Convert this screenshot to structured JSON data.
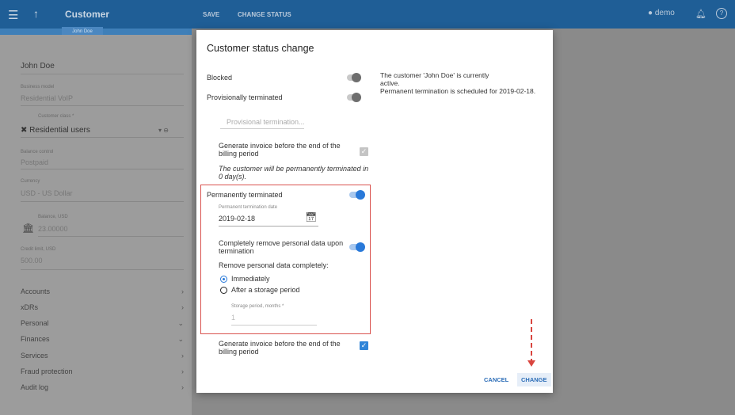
{
  "topbar": {
    "title": "Customer",
    "save_label": "SAVE",
    "change_status_label": "CHANGE STATUS",
    "user": "demo"
  },
  "subbar": {
    "tab_label": "John Doe"
  },
  "sidebar": {
    "name": "John Doe",
    "business_model_label": "Business model",
    "business_model_value": "Residential VoIP",
    "customer_class_label": "Customer class *",
    "customer_class_value": "Residential users",
    "balance_control_label": "Balance control",
    "balance_control_value": "Postpaid",
    "currency_label": "Currency",
    "currency_value": "USD - US Dollar",
    "balance_label": "Balance, USD",
    "balance_value": "23.00000",
    "credit_limit_label": "Credit limit, USD",
    "credit_limit_value": "500.00",
    "nav": [
      {
        "label": "Accounts",
        "chevron": "›"
      },
      {
        "label": "xDRs",
        "chevron": "›"
      },
      {
        "label": "Personal",
        "chevron": "⌄"
      },
      {
        "label": "Finances",
        "chevron": "⌄"
      },
      {
        "label": "Services",
        "chevron": "›"
      },
      {
        "label": "Fraud protection",
        "chevron": "›"
      },
      {
        "label": "Audit log",
        "chevron": "›"
      }
    ]
  },
  "dialog": {
    "title": "Customer status change",
    "blocked_label": "Blocked",
    "provisionally_terminated_label": "Provisionally terminated",
    "status_note": "The customer 'John Doe' is currently active.",
    "termination_note": "Permanent termination is scheduled for 2019-02-18.",
    "provisional_termination_placeholder": "Provisional termination...",
    "generate_invoice_label": "Generate invoice before the end of the billing period",
    "termination_warning": "The customer will be permanently terminated in 0 day(s).",
    "permanently_terminated_label": "Permanently terminated",
    "termination_date_label": "Permanent termination date",
    "termination_date_value": "2019-02-18",
    "remove_data_label": "Completely remove personal data upon termination",
    "remove_data_prompt": "Remove personal data completely:",
    "radio_immediately": "Immediately",
    "radio_after_storage": "After a storage period",
    "storage_period_label": "Storage period, months *",
    "storage_period_value": "1",
    "generate_invoice_label_2": "Generate invoice before the end of the billing period",
    "cancel_label": "CANCEL",
    "change_label": "CHANGE"
  },
  "colors": {
    "topbar": "#1f5e96",
    "accent": "#2979d9",
    "highlight": "#d9534f"
  },
  "icons": {
    "menu": "hamburger-icon",
    "back": "arrow-up-icon",
    "user": "account-circle-icon",
    "bell": "bell-icon",
    "help": "help-icon",
    "calendar": "calendar-icon",
    "bank": "bank-icon",
    "customer_class": "users-icon"
  }
}
